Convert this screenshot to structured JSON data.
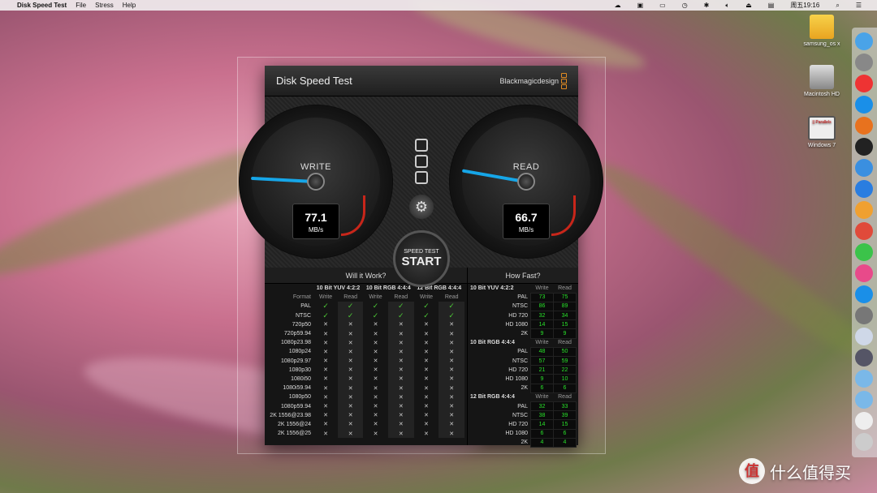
{
  "menubar": {
    "app": "Disk Speed Test",
    "items": [
      "File",
      "Stress",
      "Help"
    ],
    "clock": "周五19:16"
  },
  "desktop": {
    "icons": [
      {
        "label": "samsung_os x"
      },
      {
        "label": "Macintosh HD"
      },
      {
        "label": "Windows 7",
        "badge": "|| Parallels"
      }
    ]
  },
  "window": {
    "title": "Disk Speed Test",
    "brand": "Blackmagicdesign"
  },
  "write_gauge": {
    "label": "WRITE",
    "value": "77.1",
    "unit": "MB/s"
  },
  "read_gauge": {
    "label": "READ",
    "value": "66.7",
    "unit": "MB/s"
  },
  "start_button": {
    "small": "SPEED TEST",
    "big": "START"
  },
  "will_it_work": {
    "title": "Will it Work?",
    "format_label": "Format",
    "groups": [
      "10 Bit YUV 4:2:2",
      "10 Bit RGB 4:4:4",
      "12 Bit RGB 4:4:4"
    ],
    "sub": [
      "Write",
      "Read"
    ],
    "rows": [
      {
        "format": "PAL",
        "ok": [
          true,
          true,
          true,
          true,
          true,
          true
        ]
      },
      {
        "format": "NTSC",
        "ok": [
          true,
          true,
          true,
          true,
          true,
          true
        ]
      },
      {
        "format": "720p50",
        "ok": [
          false,
          false,
          false,
          false,
          false,
          false
        ]
      },
      {
        "format": "720p59.94",
        "ok": [
          false,
          false,
          false,
          false,
          false,
          false
        ]
      },
      {
        "format": "1080p23.98",
        "ok": [
          false,
          false,
          false,
          false,
          false,
          false
        ]
      },
      {
        "format": "1080p24",
        "ok": [
          false,
          false,
          false,
          false,
          false,
          false
        ]
      },
      {
        "format": "1080p29.97",
        "ok": [
          false,
          false,
          false,
          false,
          false,
          false
        ]
      },
      {
        "format": "1080p30",
        "ok": [
          false,
          false,
          false,
          false,
          false,
          false
        ]
      },
      {
        "format": "1080i50",
        "ok": [
          false,
          false,
          false,
          false,
          false,
          false
        ]
      },
      {
        "format": "1080i59.94",
        "ok": [
          false,
          false,
          false,
          false,
          false,
          false
        ]
      },
      {
        "format": "1080p50",
        "ok": [
          false,
          false,
          false,
          false,
          false,
          false
        ]
      },
      {
        "format": "1080p59.94",
        "ok": [
          false,
          false,
          false,
          false,
          false,
          false
        ]
      },
      {
        "format": "2K 1556@23.98",
        "ok": [
          false,
          false,
          false,
          false,
          false,
          false
        ]
      },
      {
        "format": "2K 1556@24",
        "ok": [
          false,
          false,
          false,
          false,
          false,
          false
        ]
      },
      {
        "format": "2K 1556@25",
        "ok": [
          false,
          false,
          false,
          false,
          false,
          false
        ]
      }
    ]
  },
  "how_fast": {
    "title": "How Fast?",
    "sections": [
      {
        "name": "10 Bit YUV 4:2:2",
        "write": "Write",
        "read": "Read",
        "rows": [
          [
            "PAL",
            "73",
            "75"
          ],
          [
            "NTSC",
            "86",
            "89"
          ],
          [
            "HD 720",
            "32",
            "34"
          ],
          [
            "HD 1080",
            "14",
            "15"
          ],
          [
            "2K",
            "9",
            "9"
          ]
        ]
      },
      {
        "name": "10 Bit RGB 4:4:4",
        "write": "Write",
        "read": "Read",
        "rows": [
          [
            "PAL",
            "48",
            "50"
          ],
          [
            "NTSC",
            "57",
            "59"
          ],
          [
            "HD 720",
            "21",
            "22"
          ],
          [
            "HD 1080",
            "9",
            "10"
          ],
          [
            "2K",
            "6",
            "6"
          ]
        ]
      },
      {
        "name": "12 Bit RGB 4:4:4",
        "write": "Write",
        "read": "Read",
        "rows": [
          [
            "PAL",
            "32",
            "33"
          ],
          [
            "NTSC",
            "38",
            "39"
          ],
          [
            "HD 720",
            "14",
            "15"
          ],
          [
            "HD 1080",
            "6",
            "6"
          ],
          [
            "2K",
            "4",
            "4"
          ]
        ]
      }
    ]
  },
  "watermark": {
    "logo": "值",
    "text": "什么值得买"
  },
  "colors": {
    "needle": "#16a6e8",
    "good": "#29e02a",
    "accent": "#e08a22"
  }
}
